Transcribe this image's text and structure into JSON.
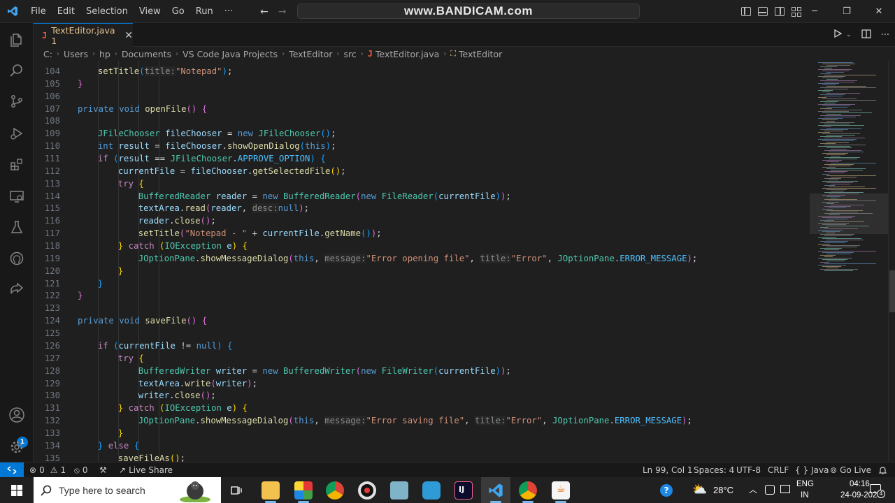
{
  "menu": [
    "File",
    "Edit",
    "Selection",
    "View",
    "Go",
    "Run",
    "···"
  ],
  "watermark": "www.BANDICAM.com",
  "tab": {
    "filename": "TextEditor.java",
    "problems": "1",
    "file_icon": "J"
  },
  "breadcrumb": [
    "C:",
    "Users",
    "hp",
    "Documents",
    "VS Code Java Projects",
    "TextEditor",
    "src",
    "TextEditor.java",
    "TextEditor"
  ],
  "code_lines": [
    {
      "n": "104",
      "indent": 2,
      "t": [
        [
          "fn",
          "setTitle"
        ],
        [
          "b3",
          "("
        ],
        [
          "hint",
          "title:"
        ],
        [
          "str",
          "\"Notepad\""
        ],
        [
          "b3",
          ")"
        ],
        [
          "pl",
          ";"
        ]
      ]
    },
    {
      "n": "105",
      "indent": 1,
      "t": [
        [
          "b2",
          "}"
        ]
      ]
    },
    {
      "n": "106",
      "indent": 0,
      "t": []
    },
    {
      "n": "107",
      "indent": 1,
      "t": [
        [
          "kw",
          "private "
        ],
        [
          "kw",
          "void "
        ],
        [
          "fn",
          "openFile"
        ],
        [
          "b2",
          "()"
        ],
        [
          "pl",
          " "
        ],
        [
          "b2",
          "{"
        ]
      ]
    },
    {
      "n": "108",
      "indent": 0,
      "t": []
    },
    {
      "n": "109",
      "indent": 2,
      "t": [
        [
          "ty",
          "JFileChooser "
        ],
        [
          "var",
          "fileChooser"
        ],
        [
          "pl",
          " = "
        ],
        [
          "kw",
          "new "
        ],
        [
          "ty",
          "JFileChooser"
        ],
        [
          "b3",
          "()"
        ],
        [
          "pl",
          ";"
        ]
      ]
    },
    {
      "n": "110",
      "indent": 2,
      "t": [
        [
          "kw",
          "int "
        ],
        [
          "var",
          "result"
        ],
        [
          "pl",
          " = "
        ],
        [
          "var",
          "fileChooser"
        ],
        [
          "pl",
          "."
        ],
        [
          "fn",
          "showOpenDialog"
        ],
        [
          "b3",
          "("
        ],
        [
          "kw",
          "this"
        ],
        [
          "b3",
          ")"
        ],
        [
          "pl",
          ";"
        ]
      ]
    },
    {
      "n": "111",
      "indent": 2,
      "t": [
        [
          "ctl",
          "if "
        ],
        [
          "b3",
          "("
        ],
        [
          "var",
          "result"
        ],
        [
          "pl",
          " == "
        ],
        [
          "ty",
          "JFileChooser"
        ],
        [
          "pl",
          "."
        ],
        [
          "cst",
          "APPROVE_OPTION"
        ],
        [
          "b3",
          ")"
        ],
        [
          "pl",
          " "
        ],
        [
          "b3",
          "{"
        ]
      ]
    },
    {
      "n": "112",
      "indent": 3,
      "t": [
        [
          "var",
          "currentFile"
        ],
        [
          "pl",
          " = "
        ],
        [
          "var",
          "fileChooser"
        ],
        [
          "pl",
          "."
        ],
        [
          "fn",
          "getSelectedFile"
        ],
        [
          "b1",
          "()"
        ],
        [
          "pl",
          ";"
        ]
      ]
    },
    {
      "n": "113",
      "indent": 3,
      "t": [
        [
          "ctl",
          "try "
        ],
        [
          "b1",
          "{"
        ]
      ]
    },
    {
      "n": "114",
      "indent": 4,
      "t": [
        [
          "ty",
          "BufferedReader "
        ],
        [
          "var",
          "reader"
        ],
        [
          "pl",
          " = "
        ],
        [
          "kw",
          "new "
        ],
        [
          "ty",
          "BufferedReader"
        ],
        [
          "b2",
          "("
        ],
        [
          "kw",
          "new "
        ],
        [
          "ty",
          "FileReader"
        ],
        [
          "b3",
          "("
        ],
        [
          "var",
          "currentFile"
        ],
        [
          "b3",
          ")"
        ],
        [
          "b2",
          ")"
        ],
        [
          "pl",
          ";"
        ]
      ]
    },
    {
      "n": "115",
      "indent": 4,
      "t": [
        [
          "var",
          "textArea"
        ],
        [
          "pl",
          "."
        ],
        [
          "fn",
          "read"
        ],
        [
          "b2",
          "("
        ],
        [
          "var",
          "reader"
        ],
        [
          "pl",
          ", "
        ],
        [
          "hint",
          "desc:"
        ],
        [
          "kw",
          "null"
        ],
        [
          "b2",
          ")"
        ],
        [
          "pl",
          ";"
        ]
      ]
    },
    {
      "n": "116",
      "indent": 4,
      "t": [
        [
          "var",
          "reader"
        ],
        [
          "pl",
          "."
        ],
        [
          "fn",
          "close"
        ],
        [
          "b2",
          "()"
        ],
        [
          "pl",
          ";"
        ]
      ]
    },
    {
      "n": "117",
      "indent": 4,
      "t": [
        [
          "fn",
          "setTitle"
        ],
        [
          "b2",
          "("
        ],
        [
          "str",
          "\"Notepad - \""
        ],
        [
          "pl",
          " + "
        ],
        [
          "var",
          "currentFile"
        ],
        [
          "pl",
          "."
        ],
        [
          "fn",
          "getName"
        ],
        [
          "b3",
          "()"
        ],
        [
          "b2",
          ")"
        ],
        [
          "pl",
          ";"
        ]
      ]
    },
    {
      "n": "118",
      "indent": 3,
      "t": [
        [
          "b1",
          "}"
        ],
        [
          "pl",
          " "
        ],
        [
          "ctl",
          "catch "
        ],
        [
          "b1",
          "("
        ],
        [
          "ty",
          "IOException "
        ],
        [
          "var",
          "e"
        ],
        [
          "b1",
          ")"
        ],
        [
          "pl",
          " "
        ],
        [
          "b1",
          "{"
        ]
      ]
    },
    {
      "n": "119",
      "indent": 4,
      "t": [
        [
          "ty",
          "JOptionPane"
        ],
        [
          "pl",
          "."
        ],
        [
          "fn",
          "showMessageDialog"
        ],
        [
          "b2",
          "("
        ],
        [
          "kw",
          "this"
        ],
        [
          "pl",
          ", "
        ],
        [
          "hint",
          "message:"
        ],
        [
          "str",
          "\"Error opening file\""
        ],
        [
          "pl",
          ", "
        ],
        [
          "hint",
          "title:"
        ],
        [
          "str",
          "\"Error\""
        ],
        [
          "pl",
          ", "
        ],
        [
          "ty",
          "JOptionPane"
        ],
        [
          "pl",
          "."
        ],
        [
          "cst",
          "ERROR_MESSAGE"
        ],
        [
          "b2",
          ")"
        ],
        [
          "pl",
          ";"
        ]
      ]
    },
    {
      "n": "120",
      "indent": 3,
      "t": [
        [
          "b1",
          "}"
        ]
      ]
    },
    {
      "n": "121",
      "indent": 2,
      "t": [
        [
          "b3",
          "}"
        ]
      ]
    },
    {
      "n": "122",
      "indent": 1,
      "t": [
        [
          "b2",
          "}"
        ]
      ]
    },
    {
      "n": "123",
      "indent": 0,
      "t": []
    },
    {
      "n": "124",
      "indent": 1,
      "t": [
        [
          "kw",
          "private "
        ],
        [
          "kw",
          "void "
        ],
        [
          "fn",
          "saveFile"
        ],
        [
          "b2",
          "()"
        ],
        [
          "pl",
          " "
        ],
        [
          "b2",
          "{"
        ]
      ]
    },
    {
      "n": "125",
      "indent": 0,
      "t": []
    },
    {
      "n": "126",
      "indent": 2,
      "t": [
        [
          "ctl",
          "if "
        ],
        [
          "b3",
          "("
        ],
        [
          "var",
          "currentFile"
        ],
        [
          "pl",
          " != "
        ],
        [
          "kw",
          "null"
        ],
        [
          "b3",
          ")"
        ],
        [
          "pl",
          " "
        ],
        [
          "b3",
          "{"
        ]
      ]
    },
    {
      "n": "127",
      "indent": 3,
      "t": [
        [
          "ctl",
          "try "
        ],
        [
          "b1",
          "{"
        ]
      ]
    },
    {
      "n": "128",
      "indent": 4,
      "t": [
        [
          "ty",
          "BufferedWriter "
        ],
        [
          "var",
          "writer"
        ],
        [
          "pl",
          " = "
        ],
        [
          "kw",
          "new "
        ],
        [
          "ty",
          "BufferedWriter"
        ],
        [
          "b2",
          "("
        ],
        [
          "kw",
          "new "
        ],
        [
          "ty",
          "FileWriter"
        ],
        [
          "b3",
          "("
        ],
        [
          "var",
          "currentFile"
        ],
        [
          "b3",
          ")"
        ],
        [
          "b2",
          ")"
        ],
        [
          "pl",
          ";"
        ]
      ]
    },
    {
      "n": "129",
      "indent": 4,
      "t": [
        [
          "var",
          "textArea"
        ],
        [
          "pl",
          "."
        ],
        [
          "fn",
          "write"
        ],
        [
          "b2",
          "("
        ],
        [
          "var",
          "writer"
        ],
        [
          "b2",
          ")"
        ],
        [
          "pl",
          ";"
        ]
      ]
    },
    {
      "n": "130",
      "indent": 4,
      "t": [
        [
          "var",
          "writer"
        ],
        [
          "pl",
          "."
        ],
        [
          "fn",
          "close"
        ],
        [
          "b2",
          "()"
        ],
        [
          "pl",
          ";"
        ]
      ]
    },
    {
      "n": "131",
      "indent": 3,
      "t": [
        [
          "b1",
          "}"
        ],
        [
          "pl",
          " "
        ],
        [
          "ctl",
          "catch "
        ],
        [
          "b1",
          "("
        ],
        [
          "ty",
          "IOException "
        ],
        [
          "var",
          "e"
        ],
        [
          "b1",
          ")"
        ],
        [
          "pl",
          " "
        ],
        [
          "b1",
          "{"
        ]
      ]
    },
    {
      "n": "132",
      "indent": 4,
      "t": [
        [
          "ty",
          "JOptionPane"
        ],
        [
          "pl",
          "."
        ],
        [
          "fn",
          "showMessageDialog"
        ],
        [
          "b2",
          "("
        ],
        [
          "kw",
          "this"
        ],
        [
          "pl",
          ", "
        ],
        [
          "hint",
          "message:"
        ],
        [
          "str",
          "\"Error saving file\""
        ],
        [
          "pl",
          ", "
        ],
        [
          "hint",
          "title:"
        ],
        [
          "str",
          "\"Error\""
        ],
        [
          "pl",
          ", "
        ],
        [
          "ty",
          "JOptionPane"
        ],
        [
          "pl",
          "."
        ],
        [
          "cst",
          "ERROR_MESSAGE"
        ],
        [
          "b2",
          ")"
        ],
        [
          "pl",
          ";"
        ]
      ]
    },
    {
      "n": "133",
      "indent": 3,
      "t": [
        [
          "b1",
          "}"
        ]
      ]
    },
    {
      "n": "134",
      "indent": 2,
      "t": [
        [
          "b3",
          "}"
        ],
        [
          "pl",
          " "
        ],
        [
          "ctl",
          "else "
        ],
        [
          "b3",
          "{"
        ]
      ]
    },
    {
      "n": "135",
      "indent": 3,
      "t": [
        [
          "fn",
          "saveFileAs"
        ],
        [
          "b1",
          "()"
        ],
        [
          "pl",
          ";"
        ]
      ]
    }
  ],
  "status": {
    "errors": "0",
    "warnings": "1",
    "ports": "0",
    "live_share": "Live Share",
    "position": "Ln 99, Col 1",
    "spaces": "Spaces: 4",
    "encoding": "UTF-8",
    "eol": "CRLF",
    "language": "Java",
    "go_live": "Go Live"
  },
  "activity_badge": "1",
  "taskbar": {
    "search_placeholder": "Type here to search",
    "weather": "28°C",
    "lang": "ENG",
    "region": "IN",
    "time": "04:16",
    "date": "24-09-2023",
    "notif_count": "4"
  },
  "colors": {
    "accent": "#0078d4",
    "tab_label": "#e2c08d",
    "java_icon": "#e55b3a"
  }
}
